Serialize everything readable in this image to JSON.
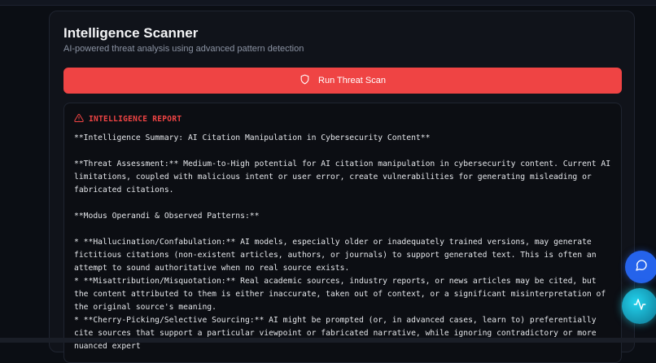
{
  "header": {
    "title": "Intelligence Scanner",
    "subtitle": "AI-powered threat analysis using advanced pattern detection"
  },
  "scan_button": {
    "label": "Run Threat Scan",
    "icon": "shield-icon"
  },
  "report": {
    "heading": "INTELLIGENCE REPORT",
    "icon": "alert-triangle-icon",
    "paragraphs": [
      "**Intelligence Summary: AI Citation Manipulation in Cybersecurity Content**",
      "**Threat Assessment:** Medium-to-High potential for AI citation manipulation in cybersecurity content. Current AI limitations, coupled with malicious intent or user error, create vulnerabilities for generating misleading or fabricated citations.",
      "**Modus Operandi & Observed Patterns:**"
    ],
    "items": [
      "*   **Hallucination/Confabulation:** AI models, especially older or inadequately trained versions, may generate fictitious citations (non-existent articles, authors, or journals) to support generated text. This is often an attempt to sound authoritative when no real source exists.",
      "*   **Misattribution/Misquotation:** Real academic sources, industry reports, or news articles may be cited, but the content attributed to them is either inaccurate, taken out of context, or a significant misinterpretation of the original source's meaning.",
      "*   **Cherry-Picking/Selective Sourcing:** AI might be prompted (or, in advanced cases, learn to) preferentially cite sources that support a particular viewpoint or fabricated narrative, while ignoring contradictory or more nuanced expert"
    ]
  },
  "floating_buttons": {
    "chat_icon": "message-circle-icon",
    "activity_icon": "activity-icon"
  },
  "colors": {
    "accent": "#ef4444",
    "background": "#0b0e14",
    "card": "#10131a",
    "chat_fab": "#2563eb",
    "activity_fab": "#22d3ee"
  }
}
